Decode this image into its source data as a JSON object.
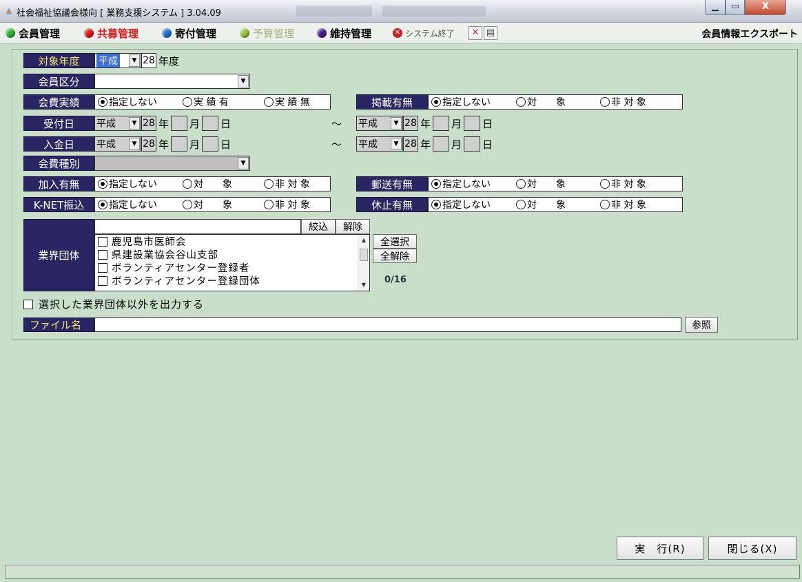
{
  "window": {
    "title": "社会福祉協議会様向 [ 業務支援システム ] 3.04.09",
    "controls": {
      "close": "X"
    }
  },
  "menu": {
    "items": [
      {
        "label": "会員管理",
        "color": "#2fb12f"
      },
      {
        "label": "共募管理",
        "color": "#e01b1b"
      },
      {
        "label": "寄付管理",
        "color": "#1f6fd0"
      },
      {
        "label": "予算管理",
        "color": "#98c13c",
        "disabled": true
      },
      {
        "label": "維持管理",
        "color": "#4a1d8a"
      }
    ],
    "system_exit": "システム終了",
    "screen_title": "会員情報エクスポート"
  },
  "form": {
    "fiscal_year": {
      "label": "対象年度",
      "era": "平成",
      "year": "28",
      "suffix": "年度"
    },
    "member_category": {
      "label": "会員区分",
      "value": ""
    },
    "fee_record": {
      "label": "会費実績",
      "options": [
        "指定しない",
        "実 績 有",
        "実 績 無"
      ],
      "selected": 0
    },
    "publication": {
      "label": "掲載有無",
      "options": [
        "指定しない",
        "対　　象",
        "非 対 象"
      ],
      "selected": 0
    },
    "received_date": {
      "label": "受付日",
      "from": {
        "era": "平成",
        "year": "28",
        "year_unit": "年",
        "month_unit": "月",
        "day_unit": "日"
      },
      "tilde": "～",
      "to": {
        "era": "平成",
        "year": "28",
        "year_unit": "年",
        "month_unit": "月",
        "day_unit": "日"
      }
    },
    "payment_date": {
      "label": "入金日",
      "from": {
        "era": "平成",
        "year": "28",
        "year_unit": "年",
        "month_unit": "月",
        "day_unit": "日"
      },
      "tilde": "～",
      "to": {
        "era": "平成",
        "year": "28",
        "year_unit": "年",
        "month_unit": "月",
        "day_unit": "日"
      }
    },
    "fee_type": {
      "label": "会費種別",
      "value": ""
    },
    "membership": {
      "label": "加入有無",
      "options": [
        "指定しない",
        "対　　象",
        "非 対 象"
      ],
      "selected": 0
    },
    "mailing": {
      "label": "郵送有無",
      "options": [
        "指定しない",
        "対　　象",
        "非 対 象"
      ],
      "selected": 0
    },
    "knet_transfer": {
      "label": "K-NET振込",
      "options": [
        "指定しない",
        "対　　象",
        "非 対 象"
      ],
      "selected": 0
    },
    "suspension": {
      "label": "休止有無",
      "options": [
        "指定しない",
        "対　　象",
        "非 対 象"
      ],
      "selected": 0
    },
    "industry_group": {
      "label": "業界団体",
      "filter_value": "",
      "filter_button": "絞込",
      "clear_button": "解除",
      "items": [
        "鹿児島市医師会",
        "県建設業協会谷山支部",
        "ボランティアセンター登録者",
        "ボランティアセンター登録団体"
      ],
      "select_all_button": "全選択",
      "deselect_all_button": "全解除",
      "count": "0/16"
    },
    "exclude_selected": {
      "label": "選択した業界団体以外を出力する",
      "checked": false
    },
    "file_name": {
      "label": "ファイル名",
      "value": "",
      "browse_button": "参照"
    }
  },
  "footer": {
    "run_button": "実　行(R)",
    "close_button": "閉じる(X)"
  },
  "colors": {
    "background": "#c9dfc9",
    "label_bg": "#2a2563",
    "label_text": "#ffffff",
    "highlight_label_text": "#f3e46a"
  }
}
